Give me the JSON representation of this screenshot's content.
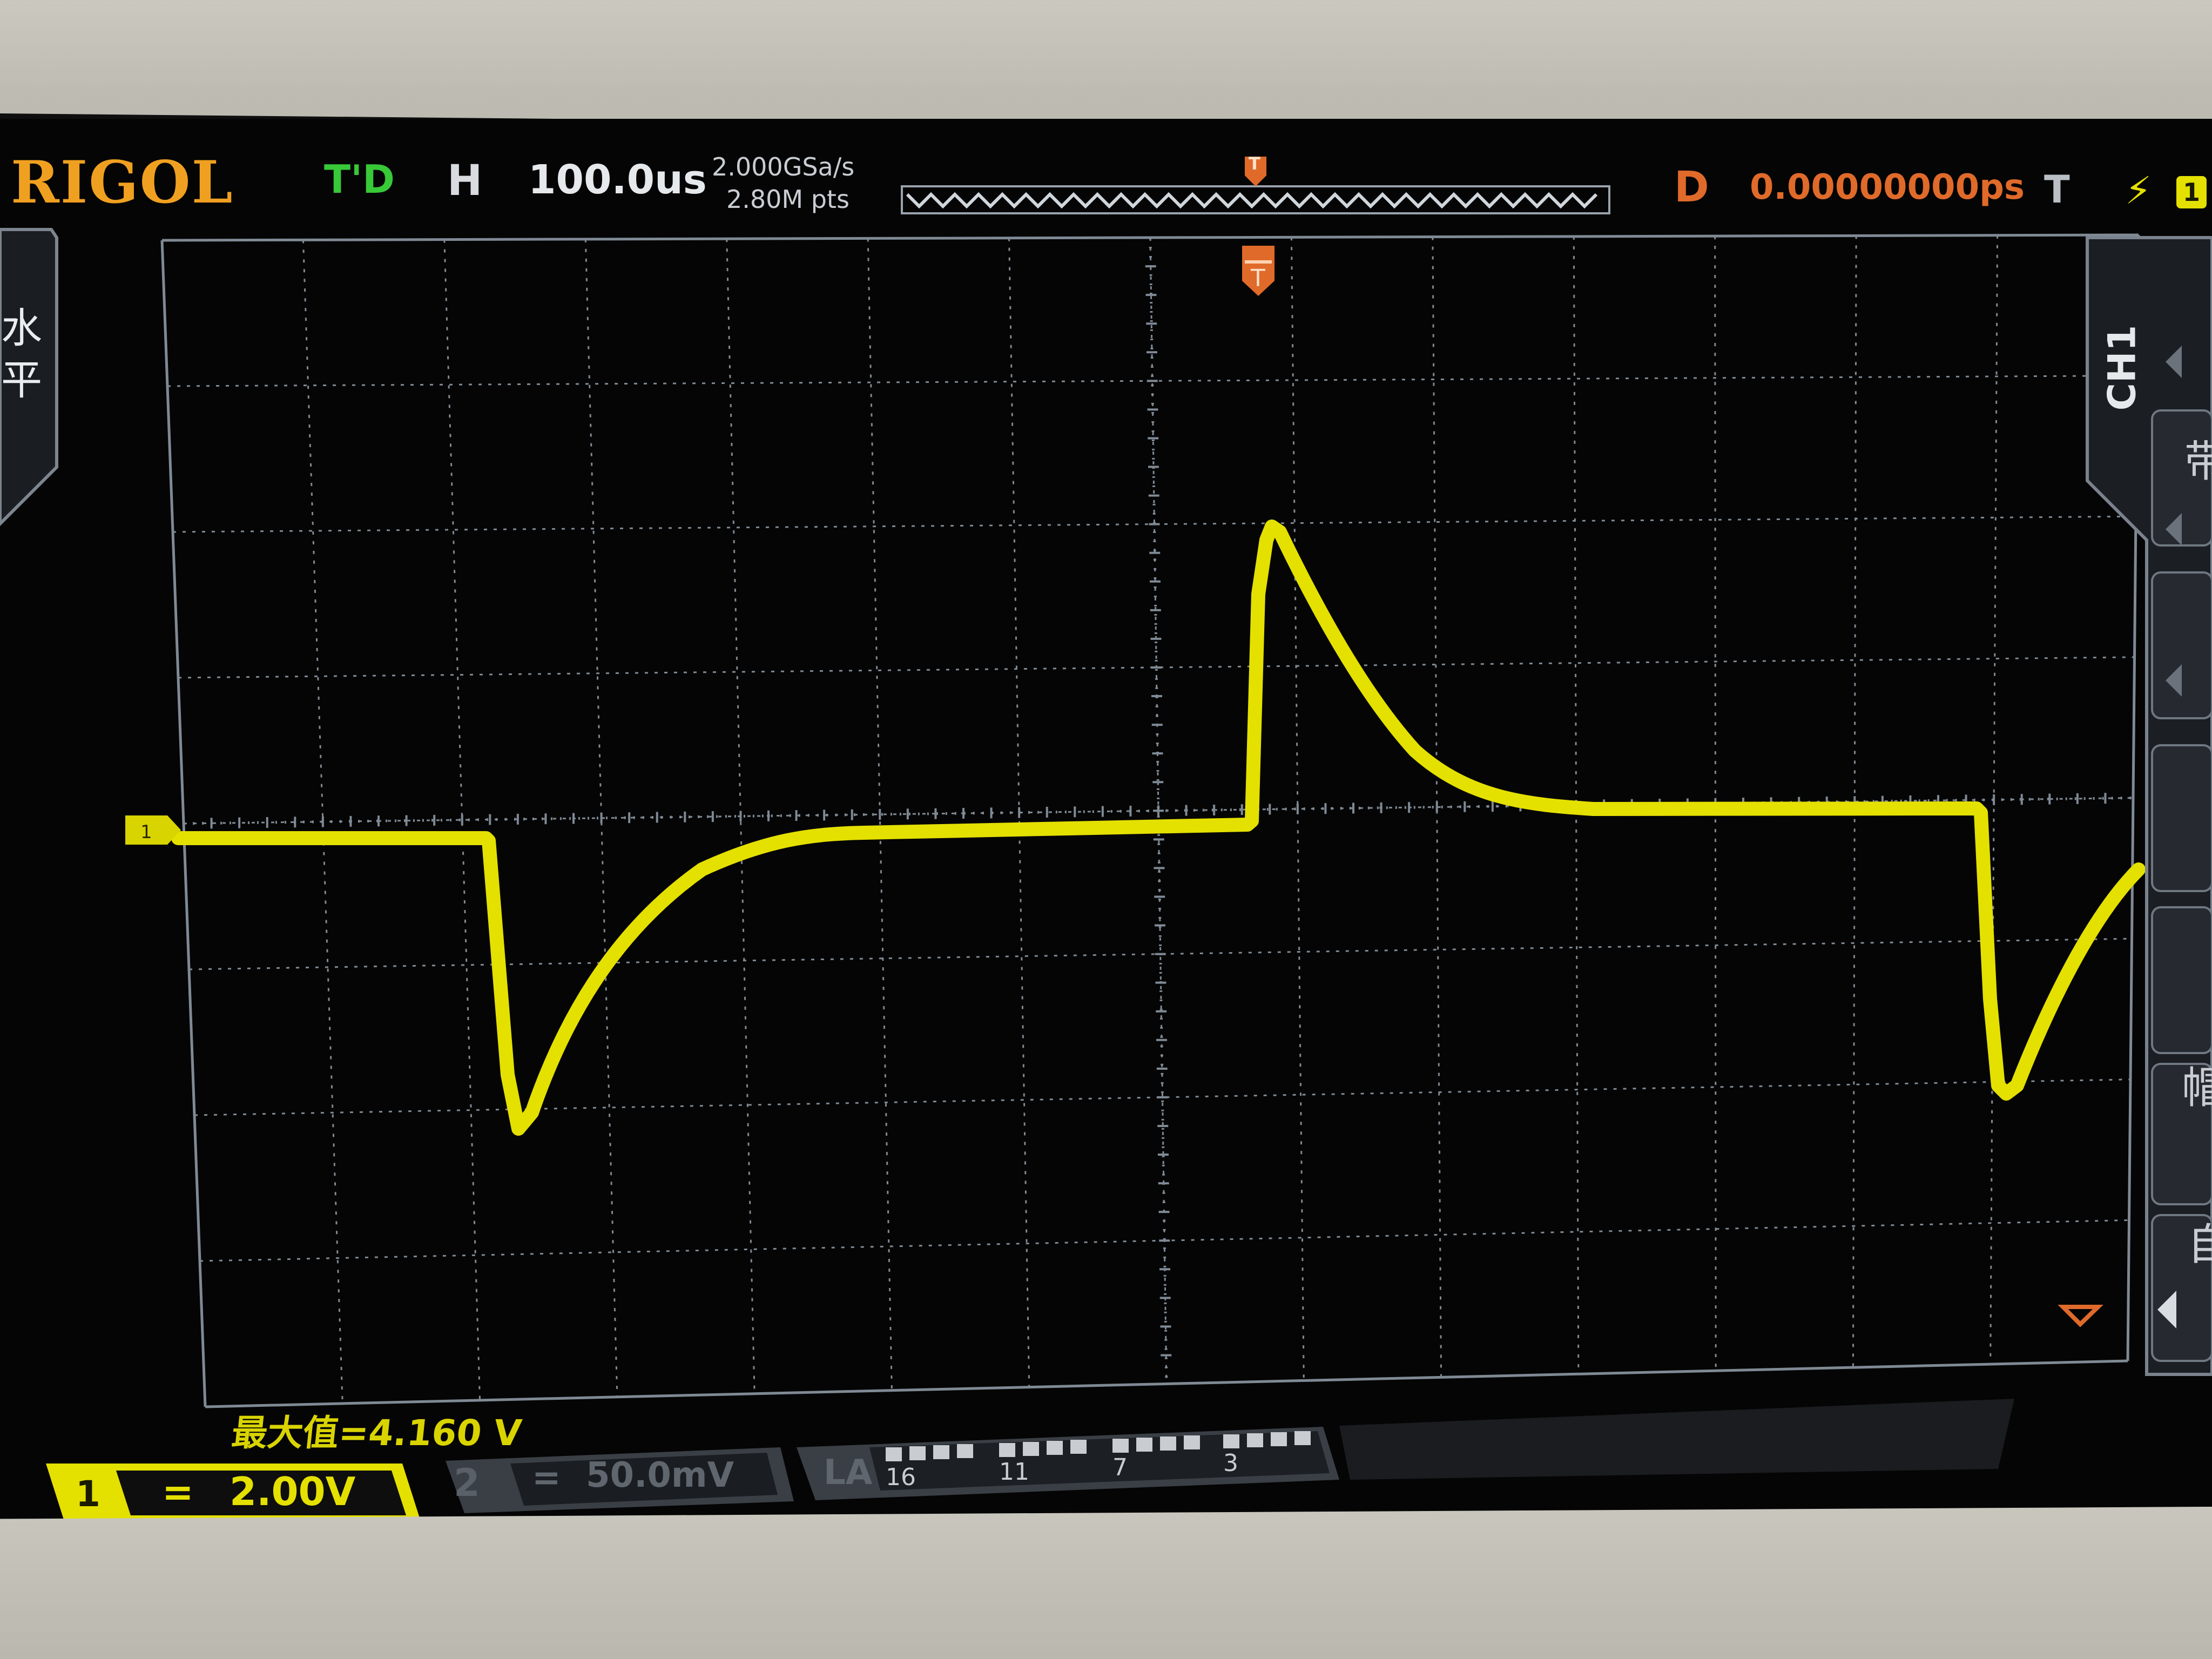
{
  "topbar": {
    "brand": "RIGOL",
    "run_status": "T'D",
    "time_base_label": "H",
    "time_base_value": "100.0us",
    "sample_rate": "2.000GSa/s",
    "memory_depth": "2.80M pts",
    "trigger_marker": "T",
    "delay_label": "D",
    "delay_value": "0.00000000ps",
    "trigger_type": "T",
    "trigger_source": "1"
  },
  "left_tab": {
    "label": "水平"
  },
  "right_menu": {
    "channel_tab": "CH1",
    "items": [
      "带",
      "帽",
      "自"
    ]
  },
  "channel1_marker": "1",
  "measurement": "最大值=4.160 V",
  "channels": [
    {
      "number": "1",
      "coupling": "=",
      "scale": "2.00V"
    },
    {
      "number": "2",
      "coupling": "=",
      "scale": "50.0mV"
    }
  ],
  "logic_analyzer": {
    "label": "LA",
    "group_labels": [
      "16",
      "11",
      "7",
      "3"
    ]
  },
  "colors": {
    "ch1_trace": "#e4e000",
    "trigger_orange": "#e06a2a",
    "status_green": "#38c838",
    "brand_orange": "#f0a020",
    "grid": "#7f8a95"
  }
}
